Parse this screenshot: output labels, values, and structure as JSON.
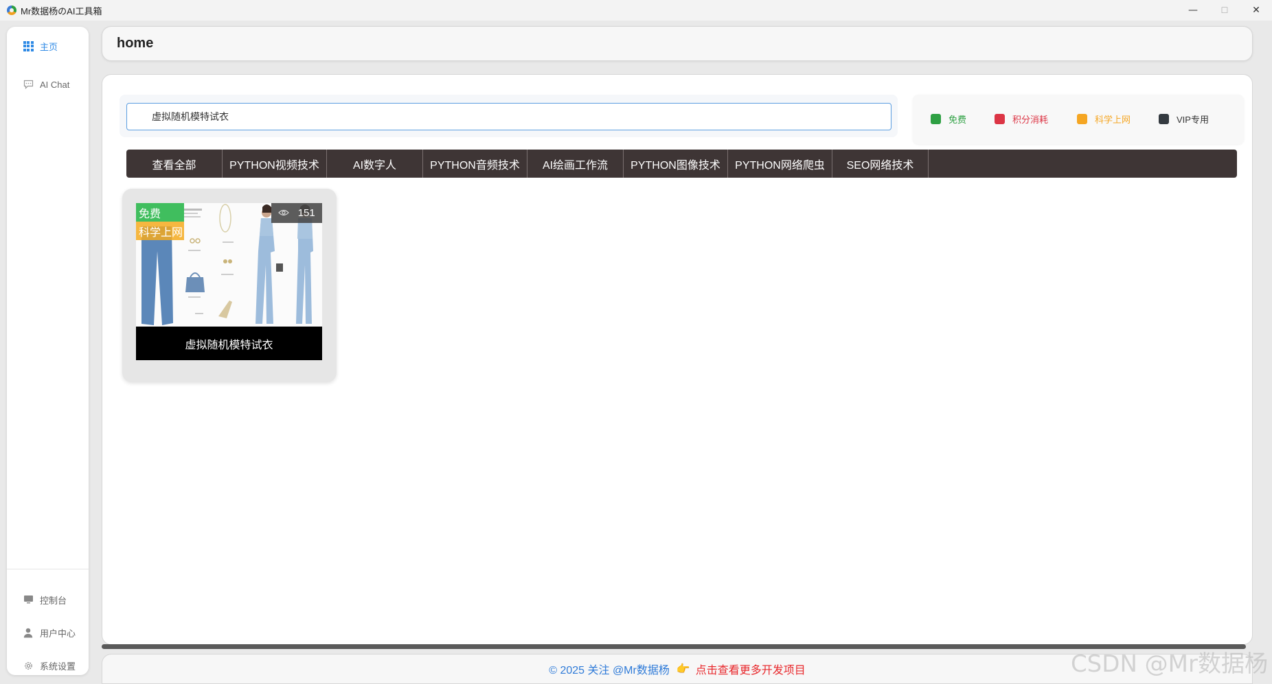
{
  "window": {
    "title": "Mr数据杨のAI工具箱",
    "minimize": "—",
    "maximize": "☐",
    "close": "✕"
  },
  "sidebar": {
    "items": [
      {
        "label": "主页",
        "icon": "grid-icon",
        "active": true
      },
      {
        "label": "AI Chat",
        "icon": "chat-icon",
        "active": false
      }
    ],
    "bottom_items": [
      {
        "label": "控制台",
        "icon": "monitor-icon"
      },
      {
        "label": "用户中心",
        "icon": "user-icon"
      },
      {
        "label": "系统设置",
        "icon": "gear-icon"
      }
    ]
  },
  "header": {
    "title": "home"
  },
  "search": {
    "value": "虚拟随机模特试衣"
  },
  "legend": [
    {
      "label": "免费",
      "color": "#2ea043"
    },
    {
      "label": "积分消耗",
      "color": "#dc3545"
    },
    {
      "label": "科学上网",
      "color": "#f5a623"
    },
    {
      "label": "VIP专用",
      "color": "#343a40"
    }
  ],
  "tabs": [
    "查看全部",
    "PYTHON视频技术",
    "AI数字人",
    "PYTHON音频技术",
    "AI绘画工作流",
    "PYTHON图像技术",
    "PYTHON网络爬虫",
    "SEO网络技术"
  ],
  "card": {
    "title": "虚拟随机模特试衣",
    "badge_free": "免费",
    "badge_vpn": "科学上网",
    "views": "151"
  },
  "footer": {
    "copyright": "© 2025 关注 @Mr数据杨",
    "hand": "👉",
    "link": "点击查看更多开发项目"
  },
  "watermark": "CSDN @Mr数据杨"
}
